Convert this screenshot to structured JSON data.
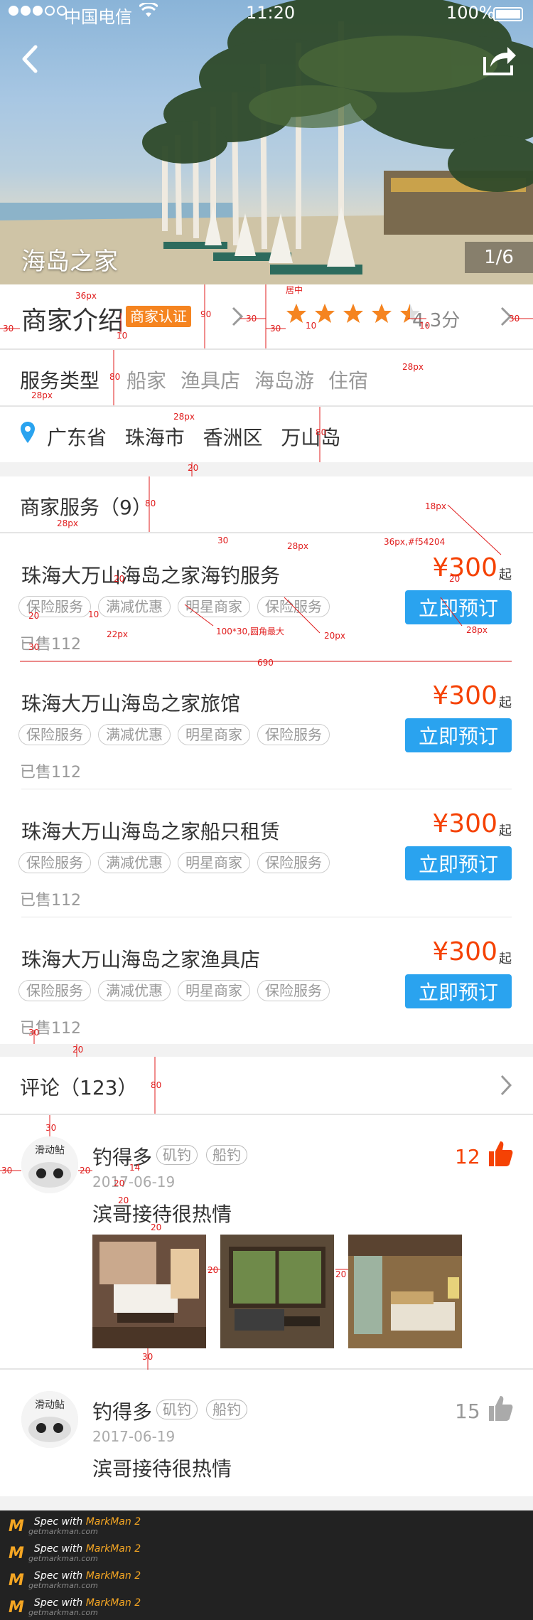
{
  "status_bar": {
    "carrier": "中国电信",
    "time": "11:20",
    "battery": "100%",
    "battery_level": 1.0
  },
  "hero": {
    "title": "海岛之家",
    "counter": "1/6",
    "back_icon": "chevron-left-icon",
    "share_icon": "share-icon"
  },
  "merchant": {
    "label": "商家介绍",
    "badge": "商家认证",
    "rating_stars": 4.5,
    "score": "4.3分",
    "colors": {
      "badge": "#f58420",
      "star": "#f58420"
    }
  },
  "service_types": {
    "title": "服务类型",
    "items": [
      "船家",
      "渔具店",
      "海岛游",
      "住宿"
    ]
  },
  "address": {
    "parts": "广东省  珠海市  香洲区  万山岛"
  },
  "services": {
    "header": "商家服务（9）",
    "items": [
      {
        "name": "珠海大万山海岛之家海钓服务",
        "price": "¥300",
        "unit": "起",
        "chips": [
          "保险服务",
          "满减优惠",
          "明星商家",
          "保险服务"
        ],
        "sold": "已售112",
        "book": "立即预订"
      },
      {
        "name": "珠海大万山海岛之家旅馆",
        "price": "¥300",
        "unit": "起",
        "chips": [
          "保险服务",
          "满减优惠",
          "明星商家",
          "保险服务"
        ],
        "sold": "已售112",
        "book": "立即预订"
      },
      {
        "name": "珠海大万山海岛之家船只租赁",
        "price": "¥300",
        "unit": "起",
        "chips": [
          "保险服务",
          "满减优惠",
          "明星商家",
          "保险服务"
        ],
        "sold": "已售112",
        "book": "立即预订"
      },
      {
        "name": "珠海大万山海岛之家渔具店",
        "price": "¥300",
        "unit": "起",
        "chips": [
          "保险服务",
          "满减优惠",
          "明星商家",
          "保险服务"
        ],
        "sold": "已售112",
        "book": "立即预订"
      }
    ],
    "colors": {
      "price": "#f54204",
      "book": "#2aa3ef"
    }
  },
  "reviews": {
    "header": "评论（123）",
    "items": [
      {
        "user": "钓得多",
        "tags": [
          "矶钓",
          "船钓"
        ],
        "date": "2017-06-19",
        "text": "滨哥接待很热情",
        "likes": "12",
        "liked": true,
        "avatar_text": "滑动鲇"
      },
      {
        "user": "钓得多",
        "tags": [
          "矶钓",
          "船钓"
        ],
        "date": "2017-06-19",
        "text": "滨哥接待很热情",
        "likes": "15",
        "liked": false,
        "avatar_text": "滑动鲇"
      }
    ]
  },
  "annotations": {
    "a36px": "36px",
    "a90": "90",
    "a10": "10",
    "a30": "30",
    "a_center": "居中",
    "a28px": "28px",
    "a80": "80",
    "a20": "20",
    "a18px": "18px",
    "a36px_color": "36px,#f54204",
    "a100x30": "100*30,圆角最大",
    "a20px": "20px",
    "a22px": "22px",
    "a690": "690",
    "a14": "14"
  },
  "footer": {
    "line": "Spec with",
    "brand": "MarkMan 2",
    "url": "getmarkman.com"
  }
}
